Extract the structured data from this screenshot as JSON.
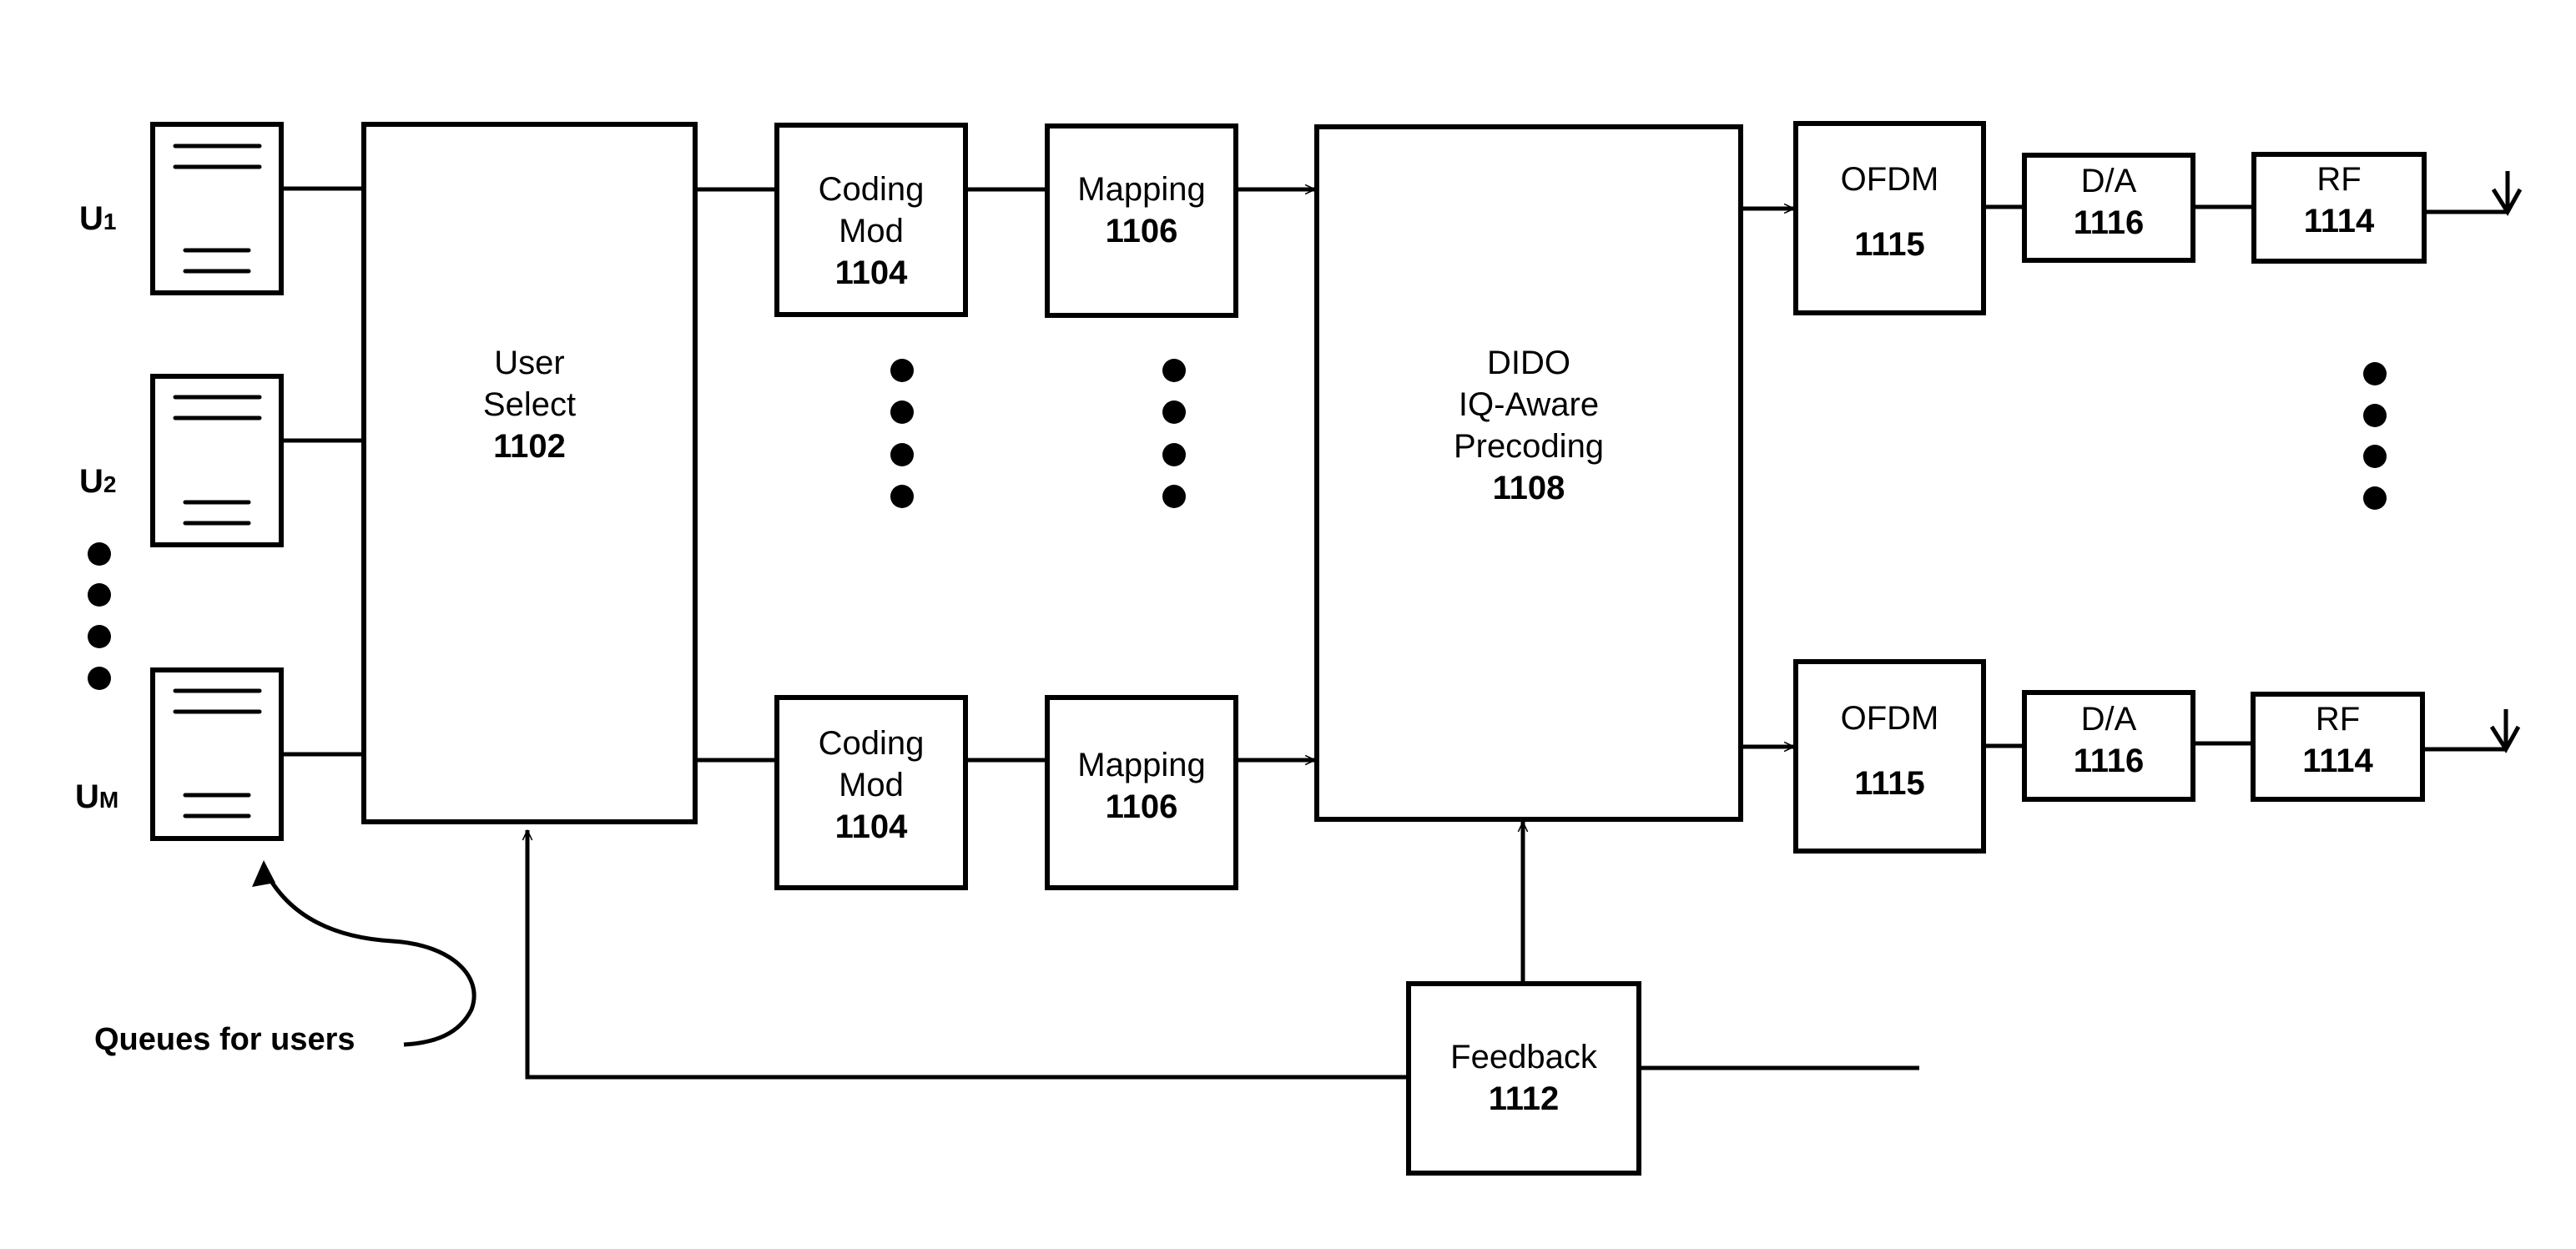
{
  "diagram": {
    "users": [
      {
        "label": "U",
        "subscript": "1"
      },
      {
        "label": "U",
        "subscript": "2"
      },
      {
        "label": "U",
        "subscript": "M"
      }
    ],
    "queue_annotation": "Queues for users",
    "blocks": {
      "user_select": {
        "lines": [
          "User",
          "Select"
        ],
        "ref": "1102"
      },
      "coding_mod_top": {
        "lines": [
          "Coding",
          "Mod"
        ],
        "ref": "1104"
      },
      "coding_mod_bottom": {
        "lines": [
          "Coding",
          "Mod"
        ],
        "ref": "1104"
      },
      "mapping_top": {
        "lines": [
          "Mapping"
        ],
        "ref": "1106"
      },
      "mapping_bottom": {
        "lines": [
          "Mapping"
        ],
        "ref": "1106"
      },
      "precoding": {
        "lines": [
          "DIDO",
          "IQ-Aware",
          "Precoding"
        ],
        "ref": "1108"
      },
      "ofdm_top": {
        "lines": [
          "OFDM"
        ],
        "ref": "1115"
      },
      "ofdm_bottom": {
        "lines": [
          "OFDM"
        ],
        "ref": "1115"
      },
      "da_top": {
        "lines": [
          "D/A"
        ],
        "ref": "1116"
      },
      "da_bottom": {
        "lines": [
          "D/A"
        ],
        "ref": "1116"
      },
      "rf_top": {
        "lines": [
          "RF"
        ],
        "ref": "1114"
      },
      "rf_bottom": {
        "lines": [
          "RF"
        ],
        "ref": "1114"
      },
      "feedback": {
        "lines": [
          "Feedback"
        ],
        "ref": "1112"
      }
    }
  }
}
